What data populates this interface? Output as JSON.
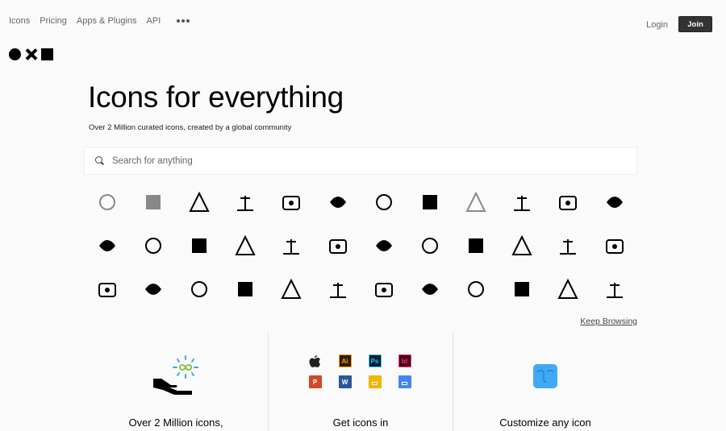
{
  "nav": {
    "items": [
      "Icons",
      "Pricing",
      "Apps & Plugins",
      "API"
    ],
    "more_icon": "ellipsis-icon"
  },
  "auth": {
    "login": "Login",
    "join": "Join"
  },
  "logo": {
    "shapes": [
      "circle",
      "cross",
      "square"
    ]
  },
  "hero": {
    "title": "Icons for everything",
    "subtitle": "Over 2 Million curated icons, created by a global community"
  },
  "search": {
    "placeholder": "Search for anything",
    "value": ""
  },
  "icon_grid": {
    "rows": [
      [
        "plant-sketch",
        "thistle",
        "ships-wheel-lamp",
        "newspaper-stand",
        "equestrian-statue",
        "sunflower-pot",
        "bowl-spoon",
        "phone-box",
        "couple-hug",
        "cooking-pot",
        "tape-roll",
        "woman-silhouette"
      ],
      [
        "torch",
        "puffin",
        "cube-box",
        "framed-badge",
        "whale-tail",
        "fruits-bunch",
        "glass-water",
        "turtle",
        "fishing-hook",
        "man-standing",
        "woman-standing",
        "dna-structure"
      ],
      [
        "woman-hijab",
        "woman-veil",
        "toy-cart",
        "skewers",
        "rat-zodiac",
        "hands-tablet",
        "goat",
        "circuit-machine",
        "crop-field",
        "ear",
        "sandbox-umbrella",
        "jungle-gym"
      ]
    ]
  },
  "keep_browsing": "Keep Browsing",
  "features": [
    {
      "title": "Over 2 Million icons,",
      "icon": "hand-infinity-icon",
      "colors": {
        "spark": "#3ca7e6",
        "infinity": "#8bc34a"
      }
    },
    {
      "title": "Get icons in",
      "icon": "apps-icon",
      "apps": [
        {
          "name": "apple",
          "label": "",
          "bg": "#fafafa",
          "fg": "#222"
        },
        {
          "name": "illustrator",
          "label": "Ai",
          "bg": "#2e1c00",
          "fg": "#ff9a00"
        },
        {
          "name": "photoshop",
          "label": "Ps",
          "bg": "#001d34",
          "fg": "#31c5f0"
        },
        {
          "name": "indesign",
          "label": "Id",
          "bg": "#49021f",
          "fg": "#ff3366"
        },
        {
          "name": "powerpoint",
          "label": "P",
          "bg": "#d24726",
          "fg": "#ffffff"
        },
        {
          "name": "word",
          "label": "W",
          "bg": "#2b579a",
          "fg": "#ffffff"
        },
        {
          "name": "google-slides",
          "label": "",
          "bg": "#f4b400",
          "fg": "#ffffff"
        },
        {
          "name": "google-docs",
          "label": "",
          "bg": "#4285f4",
          "fg": "#ffffff"
        }
      ]
    },
    {
      "title": "Customize any icon",
      "icon": "face-tile-icon",
      "colors": {
        "tile": "#3fa9f5"
      }
    }
  ]
}
